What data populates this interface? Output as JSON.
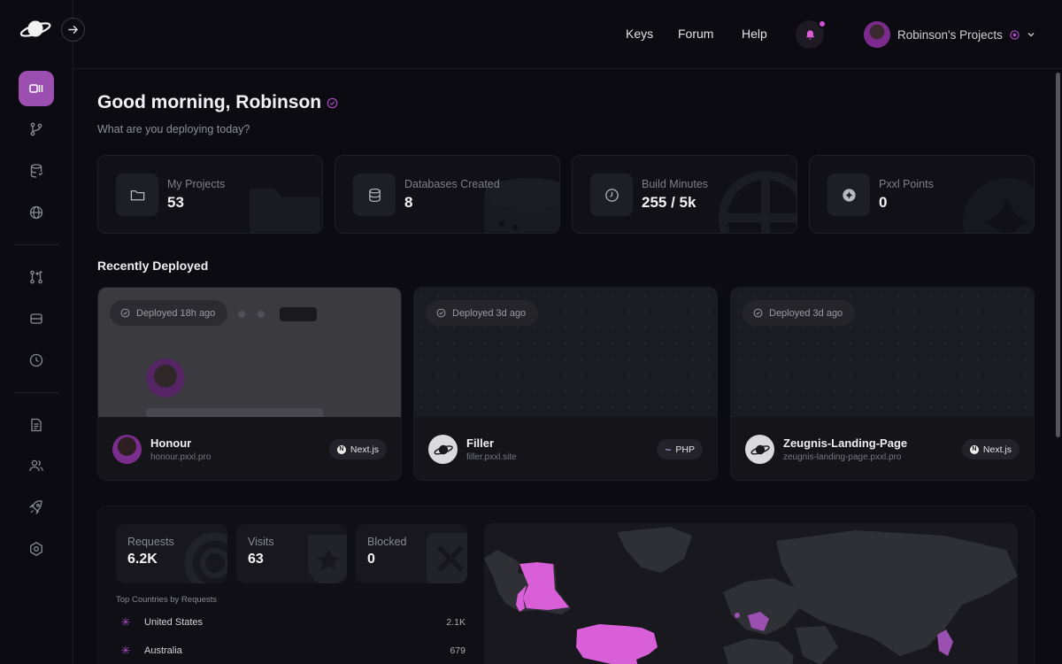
{
  "topbar": {
    "links": [
      "Keys",
      "Forum",
      "Help"
    ],
    "account_name": "Robinson's Projects"
  },
  "greeting": {
    "title": "Good morning, Robinson",
    "subtitle": "What are you deploying today?"
  },
  "stats": [
    {
      "label": "My Projects",
      "value": "53",
      "icon": "folder-icon"
    },
    {
      "label": "Databases Created",
      "value": "8",
      "icon": "database-icon"
    },
    {
      "label": "Build Minutes",
      "value": "255 / 5k",
      "icon": "clock-icon"
    },
    {
      "label": "Pxxl Points",
      "value": "0",
      "icon": "sparkle-icon"
    }
  ],
  "recent": {
    "title": "Recently Deployed",
    "projects": [
      {
        "name": "Honour",
        "url": "honour.pxxl.pro",
        "deployed": "Deployed 18h ago",
        "framework": "Next.js"
      },
      {
        "name": "Filler",
        "url": "filler.pxxl.site",
        "deployed": "Deployed 3d ago",
        "framework": "PHP"
      },
      {
        "name": "Zeugnis-Landing-Page",
        "url": "zeugnis-landing-page.pxxl.pro",
        "deployed": "Deployed 3d ago",
        "framework": "Next.js"
      }
    ]
  },
  "analytics": {
    "stats": [
      {
        "label": "Requests",
        "value": "6.2K"
      },
      {
        "label": "Visits",
        "value": "63"
      },
      {
        "label": "Blocked",
        "value": "0"
      }
    ],
    "countries_title": "Top Countries by Requests",
    "countries": [
      {
        "name": "United States",
        "value": "2.1K"
      },
      {
        "name": "Australia",
        "value": "679"
      }
    ]
  },
  "colors": {
    "accent": "#9b4fb0",
    "highlight": "#d95fd9",
    "background": "#0b0b11"
  }
}
